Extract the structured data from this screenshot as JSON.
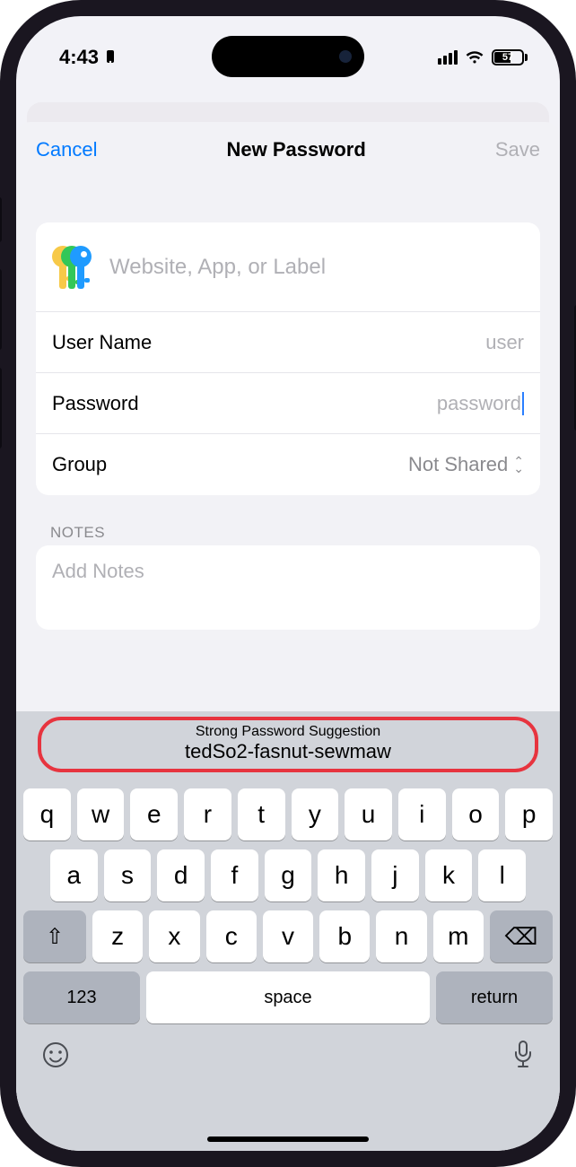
{
  "status": {
    "time": "4:43",
    "battery_pct": "57"
  },
  "nav": {
    "cancel": "Cancel",
    "title": "New Password",
    "save": "Save"
  },
  "form": {
    "site_placeholder": "Website, App, or Label",
    "username_label": "User Name",
    "username_placeholder": "user",
    "password_label": "Password",
    "password_placeholder": "password",
    "group_label": "Group",
    "group_value": "Not Shared"
  },
  "notes": {
    "header": "NOTES",
    "placeholder": "Add Notes"
  },
  "suggestion": {
    "title": "Strong Password Suggestion",
    "value": "tedSo2-fasnut-sewmaw"
  },
  "keyboard": {
    "row1": [
      "q",
      "w",
      "e",
      "r",
      "t",
      "y",
      "u",
      "i",
      "o",
      "p"
    ],
    "row2": [
      "a",
      "s",
      "d",
      "f",
      "g",
      "h",
      "j",
      "k",
      "l"
    ],
    "row3": [
      "z",
      "x",
      "c",
      "v",
      "b",
      "n",
      "m"
    ],
    "numbers": "123",
    "space": "space",
    "return": "return"
  }
}
